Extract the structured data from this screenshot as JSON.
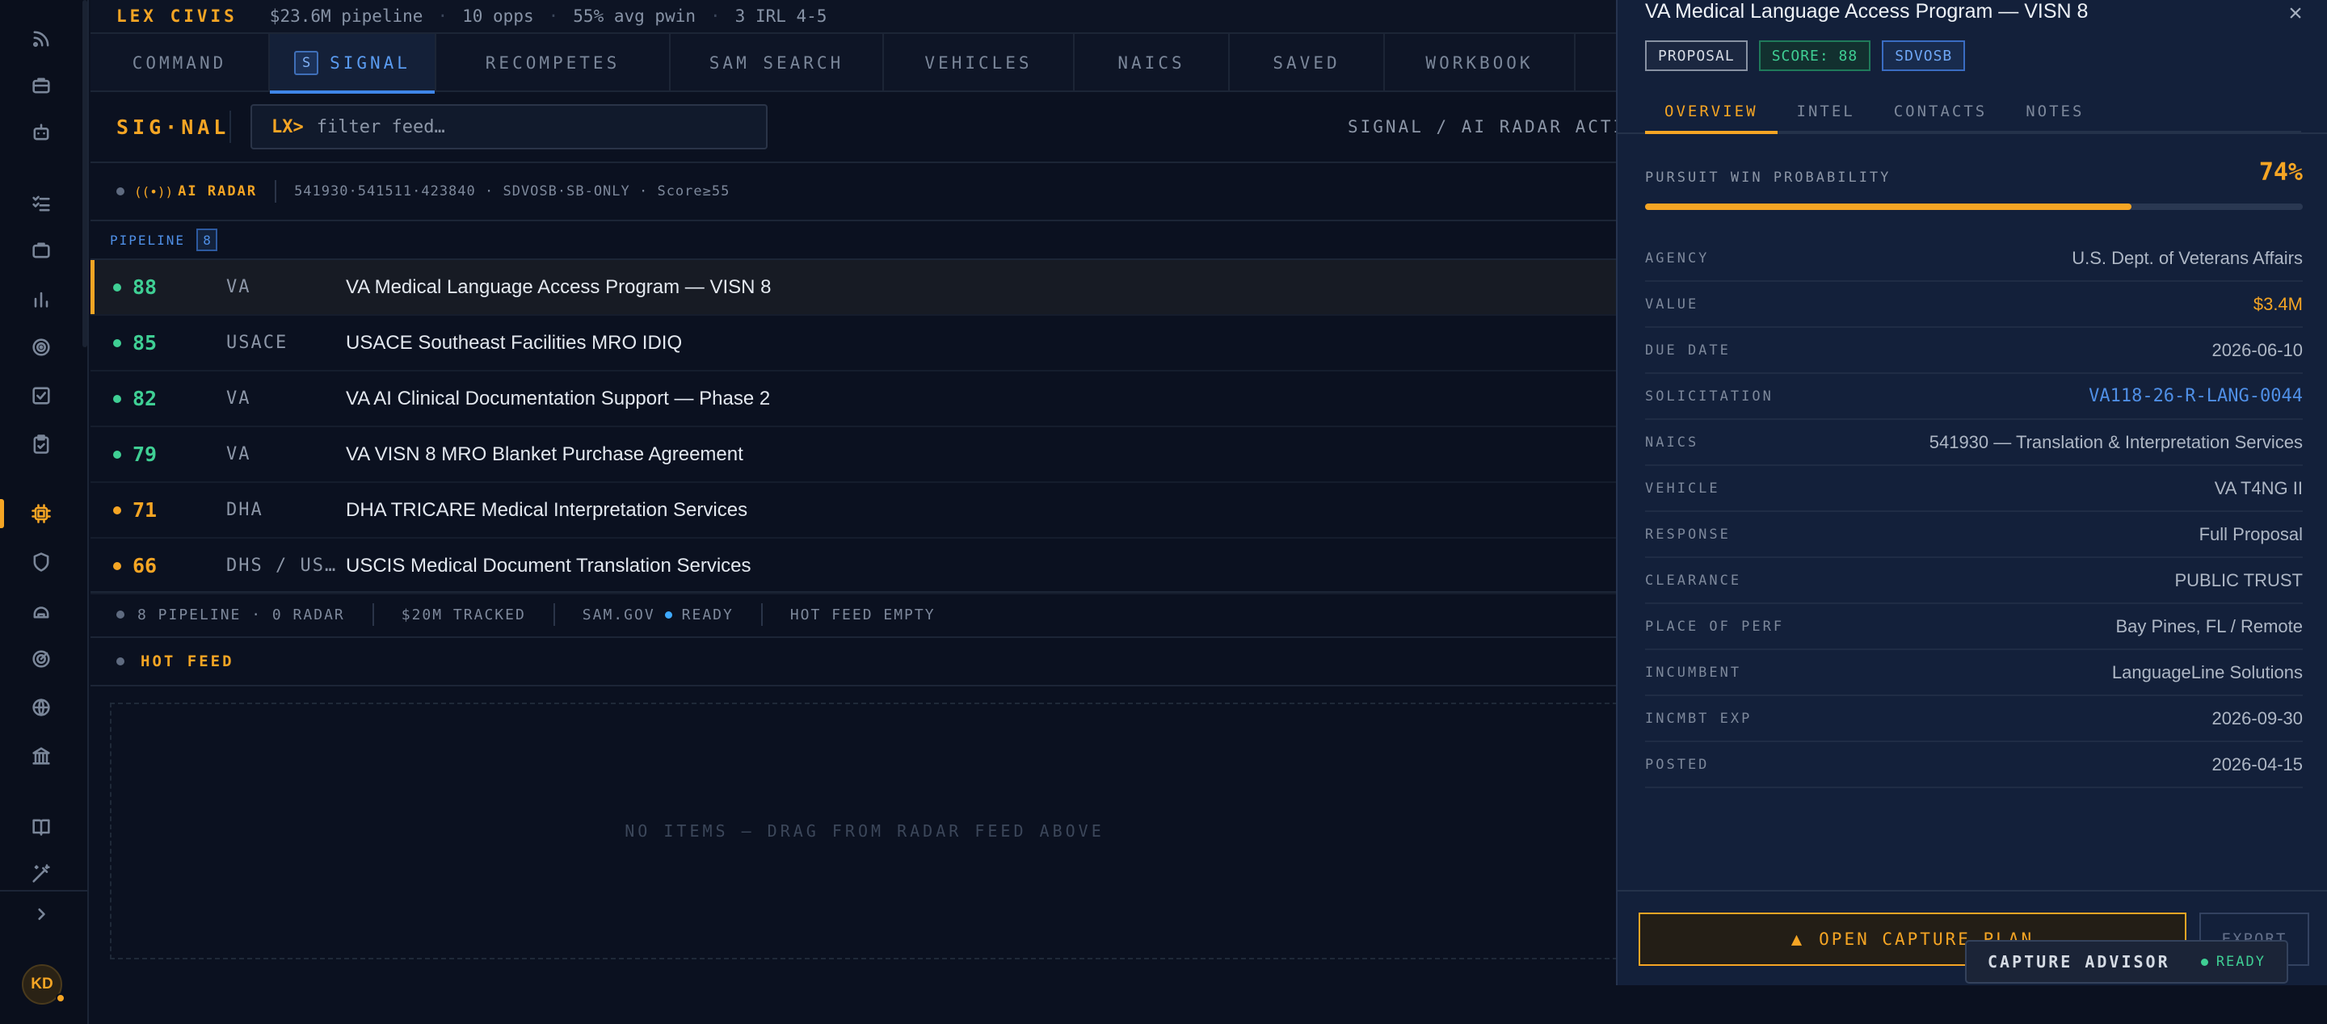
{
  "topbar": {
    "brand": "LEX CIVIS",
    "pipeline": "$23.6M pipeline",
    "opps": "10 opps",
    "pwin": "55% avg pwin",
    "irl": "3 IRL 4-5",
    "separator": "·"
  },
  "nav": {
    "tabs": [
      {
        "label": "COMMAND"
      },
      {
        "label": "SIGNAL",
        "key": "S"
      },
      {
        "label": "RECOMPETES"
      },
      {
        "label": "SAM SEARCH"
      },
      {
        "label": "VEHICLES"
      },
      {
        "label": "NAICS"
      },
      {
        "label": "SAVED"
      },
      {
        "label": "WORKBOOK"
      }
    ]
  },
  "signal": {
    "title": "SIG·NAL",
    "search_prompt": "LX>",
    "search_placeholder": "filter feed…",
    "status": "SIGNAL / AI RADAR ACTIVE"
  },
  "radar": {
    "label": "AI RADAR",
    "meta": "541930·541511·423840 · SDVOSB·SB-ONLY · Score≥55"
  },
  "pipeline": {
    "label": "PIPELINE",
    "count": "8",
    "rows": [
      {
        "score": "88",
        "agency": "VA",
        "title": "VA Medical Language Access Program — VISN 8",
        "color": "#3fcf94"
      },
      {
        "score": "85",
        "agency": "USACE",
        "title": "USACE Southeast Facilities MRO IDIQ",
        "color": "#3fcf94"
      },
      {
        "score": "82",
        "agency": "VA",
        "title": "VA AI Clinical Documentation Support — Phase 2",
        "color": "#3fcf94"
      },
      {
        "score": "79",
        "agency": "VA",
        "title": "VA VISN 8 MRO Blanket Purchase Agreement",
        "color": "#3fcf94"
      },
      {
        "score": "71",
        "agency": "DHA",
        "title": "DHA TRICARE Medical Interpretation Services",
        "color": "#f5a524"
      },
      {
        "score": "66",
        "agency": "DHS / US…",
        "title": "USCIS Medical Document Translation Services",
        "color": "#f5a524"
      }
    ]
  },
  "summary": {
    "counts": "8 PIPELINE · 0 RADAR",
    "tracked": "$20M TRACKED",
    "sam_label": "SAM.GOV",
    "sam_status": "READY",
    "hot": "HOT FEED EMPTY"
  },
  "hotfeed": {
    "label": "HOT FEED",
    "empty": "NO ITEMS — DRAG FROM RADAR FEED ABOVE"
  },
  "panel": {
    "title": "VA Medical Language Access Program — VISN 8",
    "close": "×",
    "badges": [
      "PROPOSAL",
      "SCORE: 88",
      "SDVOSB"
    ],
    "tabs": [
      "OVERVIEW",
      "INTEL",
      "CONTACTS",
      "NOTES"
    ],
    "pwin_label": "PURSUIT WIN PROBABILITY",
    "pwin_value": "74%",
    "pwin_fraction": 0.74,
    "details": [
      {
        "k": "AGENCY",
        "v": "U.S. Dept. of Veterans Affairs",
        "style": ""
      },
      {
        "k": "VALUE",
        "v": "$3.4M",
        "style": "accent"
      },
      {
        "k": "DUE DATE",
        "v": "2026-06-10",
        "style": ""
      },
      {
        "k": "SOLICITATION",
        "v": "VA118-26-R-LANG-0044",
        "style": "link"
      },
      {
        "k": "NAICS",
        "v": "541930 — Translation & Interpretation Services",
        "style": ""
      },
      {
        "k": "VEHICLE",
        "v": "VA T4NG II",
        "style": ""
      },
      {
        "k": "RESPONSE",
        "v": "Full Proposal",
        "style": ""
      },
      {
        "k": "CLEARANCE",
        "v": "PUBLIC TRUST",
        "style": ""
      },
      {
        "k": "PLACE OF PERF",
        "v": "Bay Pines, FL / Remote",
        "style": ""
      },
      {
        "k": "INCUMBENT",
        "v": "LanguageLine Solutions",
        "style": ""
      },
      {
        "k": "INCMBT EXP",
        "v": "2026-09-30",
        "style": ""
      },
      {
        "k": "POSTED",
        "v": "2026-04-15",
        "style": ""
      }
    ],
    "capture_button": "OPEN CAPTURE PLAN",
    "export_button": "EXPORT"
  },
  "advisor": {
    "name": "CAPTURE ADVISOR",
    "status": "READY"
  },
  "user": {
    "initials": "KD"
  },
  "rail_icons": [
    "feed-icon",
    "briefcase-icon",
    "robot-icon",
    "checklist-icon",
    "briefcase-icon",
    "bar-chart-icon",
    "target-icon",
    "checkbox-icon",
    "clipboard-icon",
    "chip-icon",
    "shield-icon",
    "helmet-icon",
    "radar-icon",
    "globe-icon",
    "bank-icon",
    "book-icon",
    "magic-wand-icon"
  ]
}
